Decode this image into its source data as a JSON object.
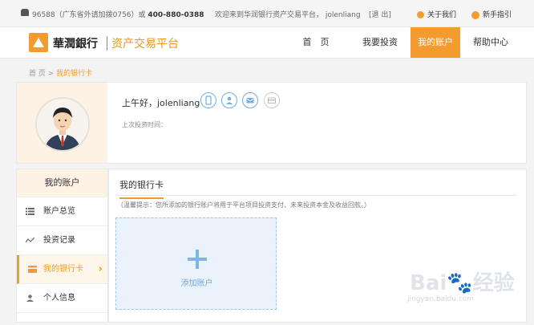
{
  "topbar": {
    "phone_text": "96588（广东省外请加拨0756）或 ",
    "phone_alt": "400-880-0388",
    "welcome": "欢迎来到华润银行资产交易平台， jolenliang",
    "logout": "[退 出]",
    "about": "关于我们",
    "guide": "新手指引"
  },
  "header": {
    "bank_name": "華潤銀行",
    "platform_name": "资产交易平台",
    "nav": [
      "首　页",
      "我要投资",
      "我的账户",
      "帮助中心"
    ],
    "active_nav": "我的账户",
    "accent_color": "#f39b2f"
  },
  "breadcrumb": {
    "home": "首 页",
    "sep": " > ",
    "current": "我的银行卡"
  },
  "profile": {
    "greeting": "上午好，jolenliang",
    "last_invest_label": "上次投资时间："
  },
  "sidebar": {
    "title": "我的账户",
    "items": [
      {
        "label": "账户总览",
        "icon": "list-icon"
      },
      {
        "label": "投资记录",
        "icon": "trend-icon"
      },
      {
        "label": "我的银行卡",
        "icon": "card-icon"
      },
      {
        "label": "个人信息",
        "icon": "user-icon"
      }
    ],
    "active_item": "我的银行卡"
  },
  "main": {
    "title": "我的银行卡",
    "tip": "（温馨提示：您所添加的银行账户将用于平台项目投资支付、未来投资本金及收益回款。）",
    "add_label": "添加账户"
  },
  "watermark": {
    "text": "Bai🐾经验",
    "sub": "jingyan.baidu.com"
  }
}
